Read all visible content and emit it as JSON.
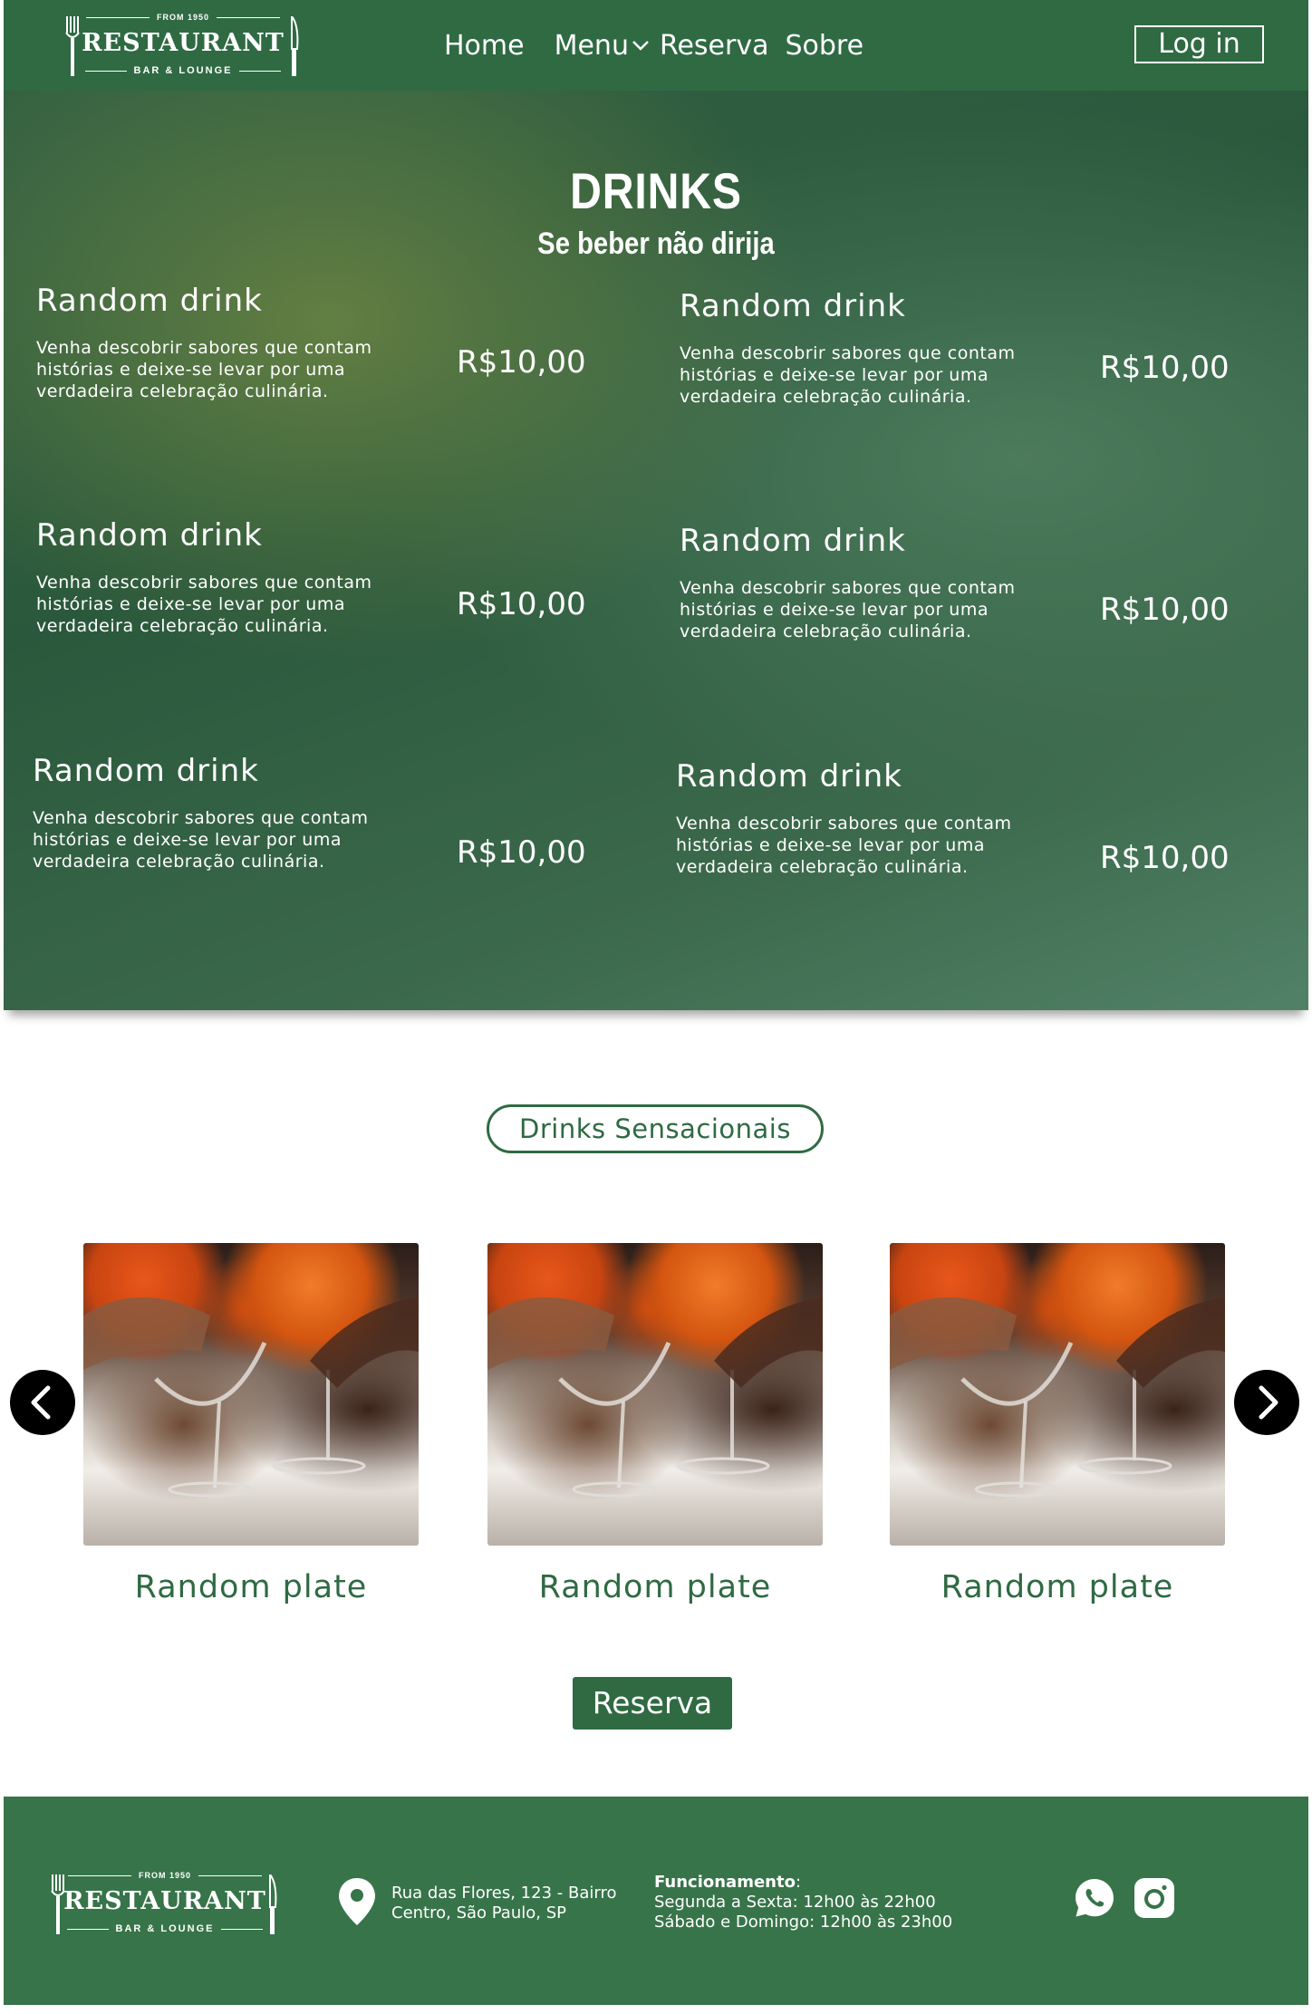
{
  "brand": {
    "from": "FROM 1950",
    "name": "RESTAURANT",
    "sub": "BAR & LOUNGE"
  },
  "nav": {
    "home": "Home",
    "menu": "Menu",
    "reserva": "Reserva",
    "sobre": "Sobre",
    "login": "Log in"
  },
  "hero": {
    "title": "DRINKS",
    "subtitle": "Se beber não dirija",
    "drinks": [
      {
        "name": "Random drink",
        "desc": "Venha descobrir sabores que contam histórias e deixe-se levar por uma verdadeira celebração culinária.",
        "price": "R$10,00"
      },
      {
        "name": "Random drink",
        "desc": "Venha descobrir sabores que contam histórias e deixe-se levar por uma verdadeira celebração culinária.",
        "price": "R$10,00"
      },
      {
        "name": "Random drink",
        "desc": "Venha descobrir sabores que contam histórias e deixe-se levar por uma verdadeira celebração culinária.",
        "price": "R$10,00"
      },
      {
        "name": "Random drink",
        "desc": "Venha descobrir sabores que contam histórias e deixe-se levar por uma verdadeira celebração culinária.",
        "price": "R$10,00"
      },
      {
        "name": "Random drink",
        "desc": "Venha descobrir sabores que contam histórias e deixe-se levar por uma verdadeira celebração culinária.",
        "price": "R$10,00"
      },
      {
        "name": "Random drink",
        "desc": "Venha descobrir sabores que contam histórias e deixe-se levar por uma verdadeira celebração culinária.",
        "price": "R$10,00"
      }
    ]
  },
  "section": {
    "badge": "Drinks Sensacionais",
    "cards": [
      {
        "title": "Random plate"
      },
      {
        "title": "Random plate"
      },
      {
        "title": "Random plate"
      }
    ],
    "reserva_button": "Reserva"
  },
  "footer": {
    "address": "Rua das Flores, 123 - Bairro Centro, São Paulo, SP",
    "hours_title": "Funcionamento",
    "hours_line1": "Segunda a Sexta: 12h00 às 22h00",
    "hours_line2": "Sábado e Domingo: 12h00 às 23h00",
    "icons": [
      "whatsapp-icon",
      "instagram-icon"
    ]
  },
  "colors": {
    "brand_green": "#2f6a43",
    "footer_green": "#377449",
    "white": "#ffffff"
  }
}
